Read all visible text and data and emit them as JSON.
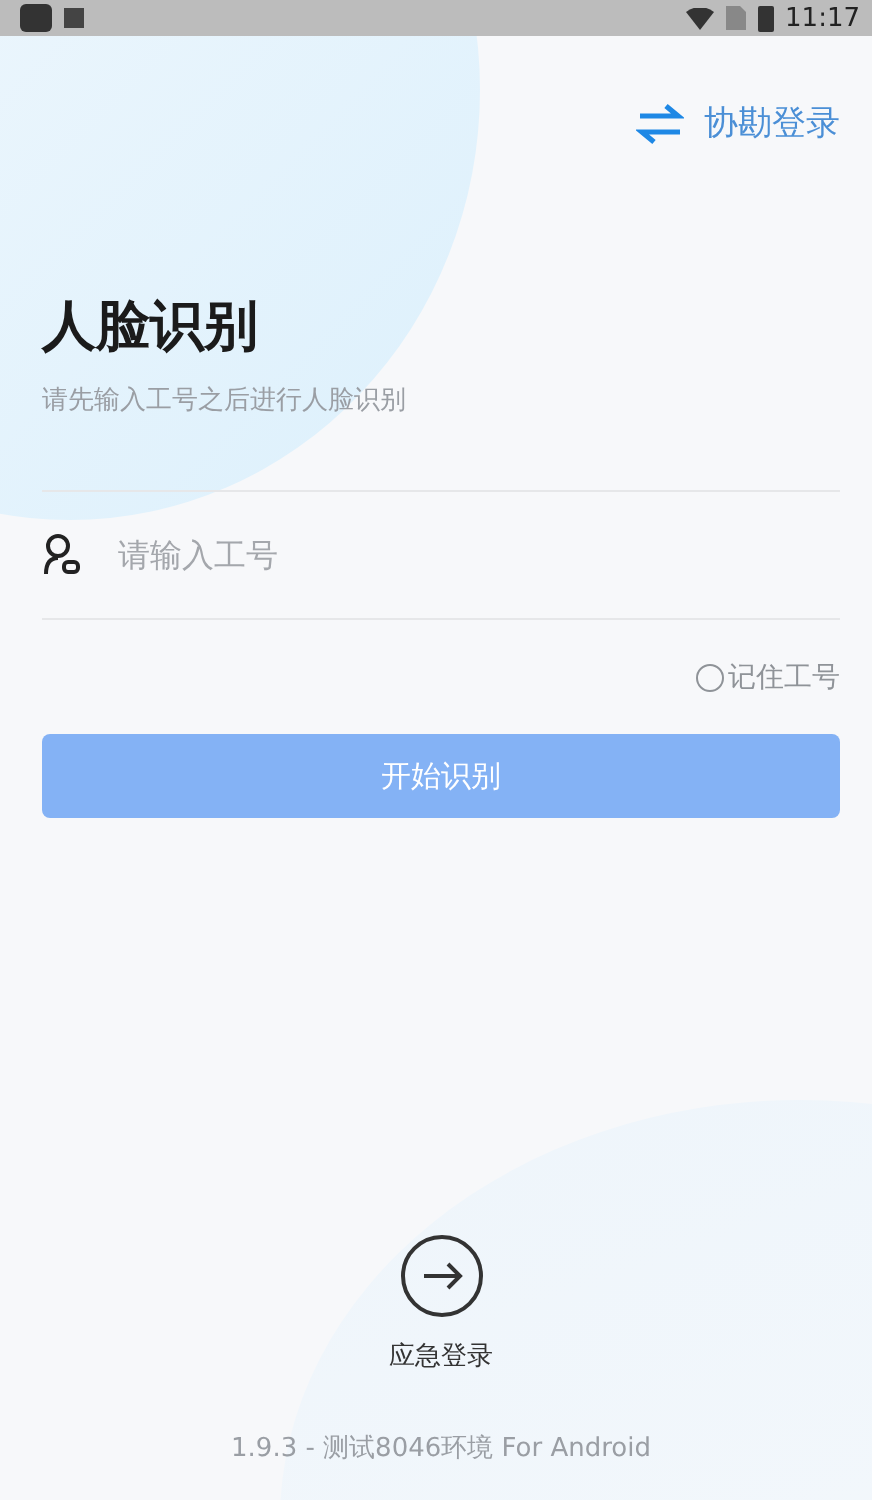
{
  "status_bar": {
    "time": "11:17"
  },
  "assist_login": {
    "label": "协勘登录"
  },
  "title": "人脸识别",
  "subtitle": "请先输入工号之后进行人脸识别",
  "employee_field": {
    "placeholder": "请输入工号"
  },
  "remember": {
    "label": "记住工号",
    "checked": false
  },
  "start_button": {
    "label": "开始识别",
    "disabled": true
  },
  "emergency_login": {
    "label": "应急登录"
  },
  "version": "1.9.3 - 测试8046环境 For Android"
}
